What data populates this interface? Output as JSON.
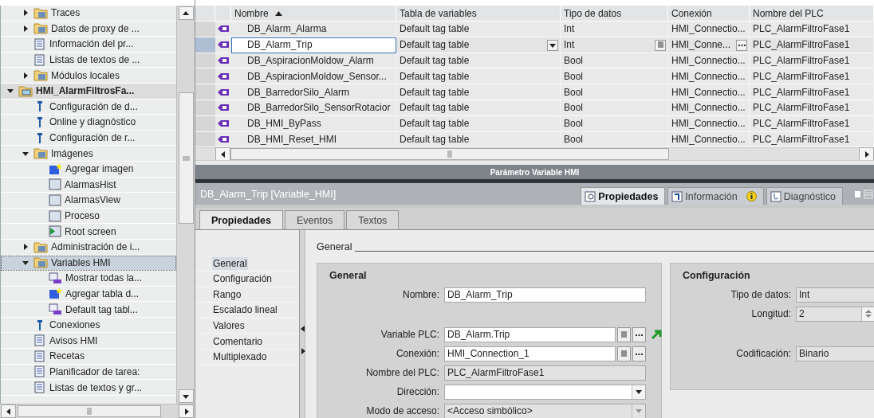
{
  "tree": [
    {
      "children": [
        {
          "label": "Traces",
          "kind": "folder",
          "expanded": false,
          "selected": false
        },
        {
          "label": "Datos de proxy de ...",
          "kind": "folder",
          "expanded": false,
          "selected": false
        },
        {
          "label": "Información del pr...",
          "kind": "doc",
          "selected": false
        },
        {
          "label": "Listas de textos de ...",
          "kind": "doc",
          "selected": false
        },
        {
          "label": "Módulos locales",
          "kind": "folder",
          "expanded": false,
          "selected": false
        }
      ]
    },
    {
      "label": "HMI_AlarmFiltrosFa...",
      "kind": "device",
      "expanded": true,
      "selected": false,
      "current": true,
      "children": [
        {
          "label": "Configuración de d...",
          "kind": "tool",
          "selected": false
        },
        {
          "label": "Online y diagnóstico",
          "kind": "tool",
          "selected": false
        },
        {
          "label": "Configuración de r...",
          "kind": "tool",
          "selected": false
        },
        {
          "label": "Imágenes",
          "kind": "folder",
          "expanded": true,
          "selected": false,
          "children": [
            {
              "label": "Agregar imagen",
              "kind": "add",
              "selected": false
            },
            {
              "label": "AlarmasHist",
              "kind": "screen",
              "selected": false
            },
            {
              "label": "AlarmasView",
              "kind": "screen",
              "selected": false
            },
            {
              "label": "Proceso",
              "kind": "screen",
              "selected": false
            },
            {
              "label": "Root screen",
              "kind": "root",
              "selected": false
            }
          ]
        },
        {
          "label": "Administración de i...",
          "kind": "folder",
          "expanded": false,
          "selected": false
        },
        {
          "label": "Variables HMI",
          "kind": "folder",
          "expanded": true,
          "selected": true,
          "children": [
            {
              "label": "Mostrar todas la...",
              "kind": "tags",
              "selected": false
            },
            {
              "label": "Agregar tabla d...",
              "kind": "add",
              "selected": false
            },
            {
              "label": "Default tag tabl...",
              "kind": "tags",
              "selected": false
            }
          ]
        },
        {
          "label": "Conexiones",
          "kind": "tool",
          "selected": false
        },
        {
          "label": "Avisos HMI",
          "kind": "doc",
          "selected": false
        },
        {
          "label": "Recetas",
          "kind": "doc",
          "selected": false
        },
        {
          "label": "Planificador de tarea:",
          "kind": "doc",
          "selected": false
        },
        {
          "label": "Listas de textos y gr...",
          "kind": "doc",
          "selected": false
        }
      ]
    }
  ],
  "table": {
    "columns": [
      {
        "label": "Nombre",
        "sorted": true
      },
      {
        "label": "Tabla de variables",
        "sorted": false
      },
      {
        "label": "Tipo de datos",
        "sorted": false
      },
      {
        "label": "Conexión",
        "sorted": false
      },
      {
        "label": "Nombre del PLC",
        "sorted": false
      }
    ],
    "rows": [
      {
        "name": "DB_Alarm_Alarma",
        "table": "Default tag table",
        "type": "Int",
        "connection": "HMI_Connectio...",
        "plc": "PLC_AlarmFiltroFase1",
        "selected": false
      },
      {
        "name": "DB_Alarm_Trip",
        "table": "Default tag table",
        "type": "Int",
        "connection": "HMI_Conne...",
        "plc": "PLC_AlarmFiltroFase1",
        "selected": true
      },
      {
        "name": "DB_AspiracionMoldow_Alarm",
        "table": "Default tag table",
        "type": "Bool",
        "connection": "HMI_Connectio...",
        "plc": "PLC_AlarmFiltroFase1",
        "selected": false
      },
      {
        "name": "DB_AspiracionMoldow_Sensor...",
        "table": "Default tag table",
        "type": "Bool",
        "connection": "HMI_Connectio...",
        "plc": "PLC_AlarmFiltroFase1",
        "selected": false
      },
      {
        "name": "DB_BarredorSilo_Alarm",
        "table": "Default tag table",
        "type": "Bool",
        "connection": "HMI_Connectio...",
        "plc": "PLC_AlarmFiltroFase1",
        "selected": false
      },
      {
        "name": "DB_BarredorSilo_SensorRotacior",
        "table": "Default tag table",
        "type": "Bool",
        "connection": "HMI_Connectio...",
        "plc": "PLC_AlarmFiltroFase1",
        "selected": false
      },
      {
        "name": "DB_HMI_ByPass",
        "table": "Default tag table",
        "type": "Bool",
        "connection": "HMI_Connectio...",
        "plc": "PLC_AlarmFiltroFase1",
        "selected": false
      },
      {
        "name": "DB_HMI_Reset_HMI",
        "table": "Default tag table",
        "type": "Bool",
        "connection": "HMI_Connectio...",
        "plc": "PLC_AlarmFiltroFase1",
        "selected": false
      }
    ]
  },
  "editor_title": "Parámetro Variable HMI",
  "inspector": {
    "title": "DB_Alarm_Trip [Variable_HMI]",
    "view_tabs": [
      {
        "label": "Propiedades",
        "kind": "properties",
        "selected": true
      },
      {
        "label": "Información",
        "kind": "info",
        "selected": false
      },
      {
        "label": "Diagnóstico",
        "kind": "diagnostics",
        "selected": false
      }
    ],
    "tabs": [
      {
        "label": "Propiedades",
        "selected": true
      },
      {
        "label": "Eventos",
        "selected": false
      },
      {
        "label": "Textos",
        "selected": false
      }
    ],
    "nav": [
      {
        "label": "General",
        "selected": true
      },
      {
        "label": "Configuración",
        "selected": false
      },
      {
        "label": "Rango",
        "selected": false
      },
      {
        "label": "Escalado lineal",
        "selected": false
      },
      {
        "label": "Valores",
        "selected": false
      },
      {
        "label": "Comentario",
        "selected": false
      },
      {
        "label": "Multiplexado",
        "selected": false
      }
    ],
    "section": "General",
    "general": {
      "title": "General",
      "fields": [
        {
          "label": "Nombre:",
          "value": "DB_Alarm_Trip",
          "kind": "text"
        },
        {
          "label": "Variable PLC:",
          "value": "DB_Alarm.Trip",
          "kind": "link"
        },
        {
          "label": "Conexión:",
          "value": "HMI_Connection_1",
          "kind": "picker"
        },
        {
          "label": "Nombre del PLC:",
          "value": "PLC_AlarmFiltroFase1",
          "kind": "readonly"
        },
        {
          "label": "Dirección:",
          "kind": "dropdown"
        },
        {
          "label": "Modo de acceso:",
          "value": "<Acceso simbólico>",
          "kind": "disabled-dropdown"
        }
      ]
    },
    "configuration": {
      "title": "Configuración",
      "fields": [
        {
          "label": "Tipo de datos:",
          "value": "Int",
          "kind": "readonly"
        },
        {
          "label": "Longitud:",
          "value": "2",
          "kind": "spinner"
        },
        {
          "label": "Codificación:",
          "value": "Binario",
          "kind": "readonly"
        }
      ]
    }
  }
}
